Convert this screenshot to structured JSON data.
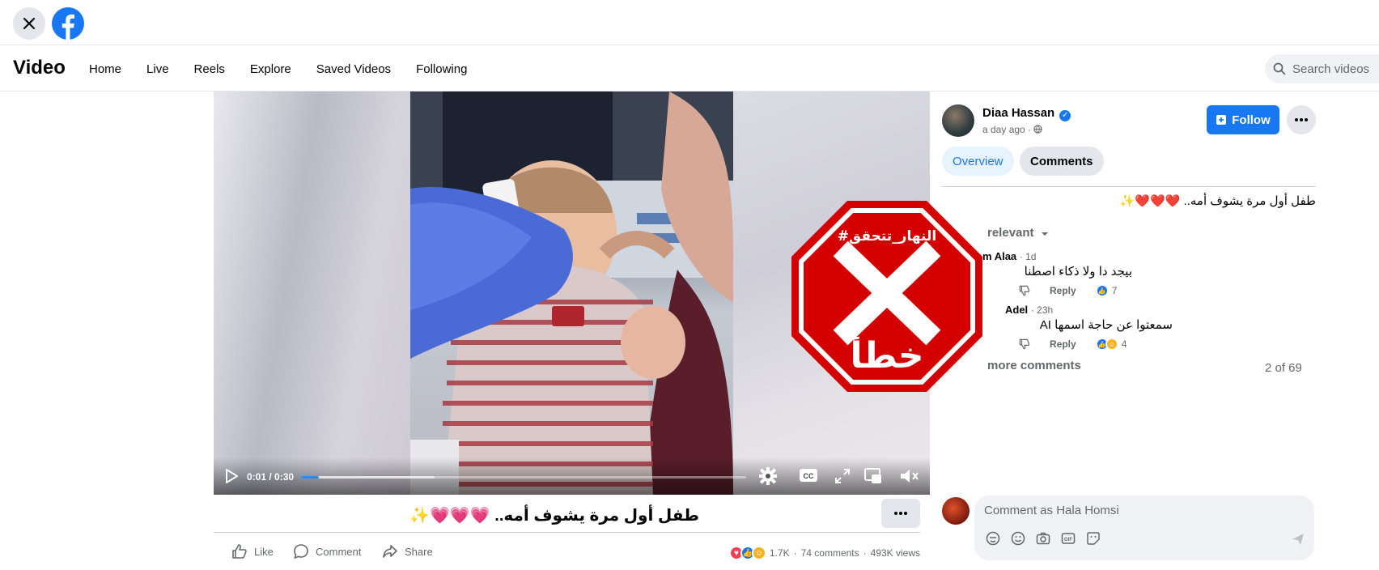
{
  "header": {
    "close_icon": "close-icon",
    "logo_icon": "facebook-logo-icon"
  },
  "nav": {
    "title": "Video",
    "links": [
      "Home",
      "Live",
      "Reels",
      "Explore",
      "Saved Videos",
      "Following"
    ],
    "search_placeholder": "Search videos"
  },
  "player": {
    "time": "0:01 / 0:30",
    "progress": 0.04,
    "buffered": 0.3,
    "stamp_hashtag": "#النهار_تتحقق",
    "stamp_verdict": "خطأ",
    "stamp_color": "#d40000"
  },
  "post": {
    "title": "طفل أول مرة يشوف أمه.. 💗💗💗✨",
    "like_label": "Like",
    "comment_label": "Comment",
    "share_label": "Share",
    "reactions_count": "1.7K",
    "comments_count": "74 comments",
    "views": "493K views"
  },
  "side": {
    "author_name": "Diaa Hassan",
    "time": "a day ago",
    "follow_label": "Follow",
    "tabs": [
      "Overview",
      "Comments"
    ],
    "description": "طفل أول مرة يشوف أمه.. ❤️❤️❤️✨",
    "sort_label": "relevant",
    "comments": [
      {
        "author": "m Alaa",
        "time": "1d",
        "text": "بيجد دا ولا ذكاء اصطنا",
        "reply": "Reply",
        "likes": "7"
      },
      {
        "author": "Adel",
        "time": "23h",
        "text": "سمعتوا عن حاجة اسمها AI",
        "reply": "Reply",
        "likes": "4"
      }
    ],
    "view_more": "more comments",
    "count": "2 of 69",
    "composer_placeholder": "Comment as Hala Homsi"
  },
  "colors": {
    "accent": "#1877f2",
    "stamp": "#d40000"
  }
}
